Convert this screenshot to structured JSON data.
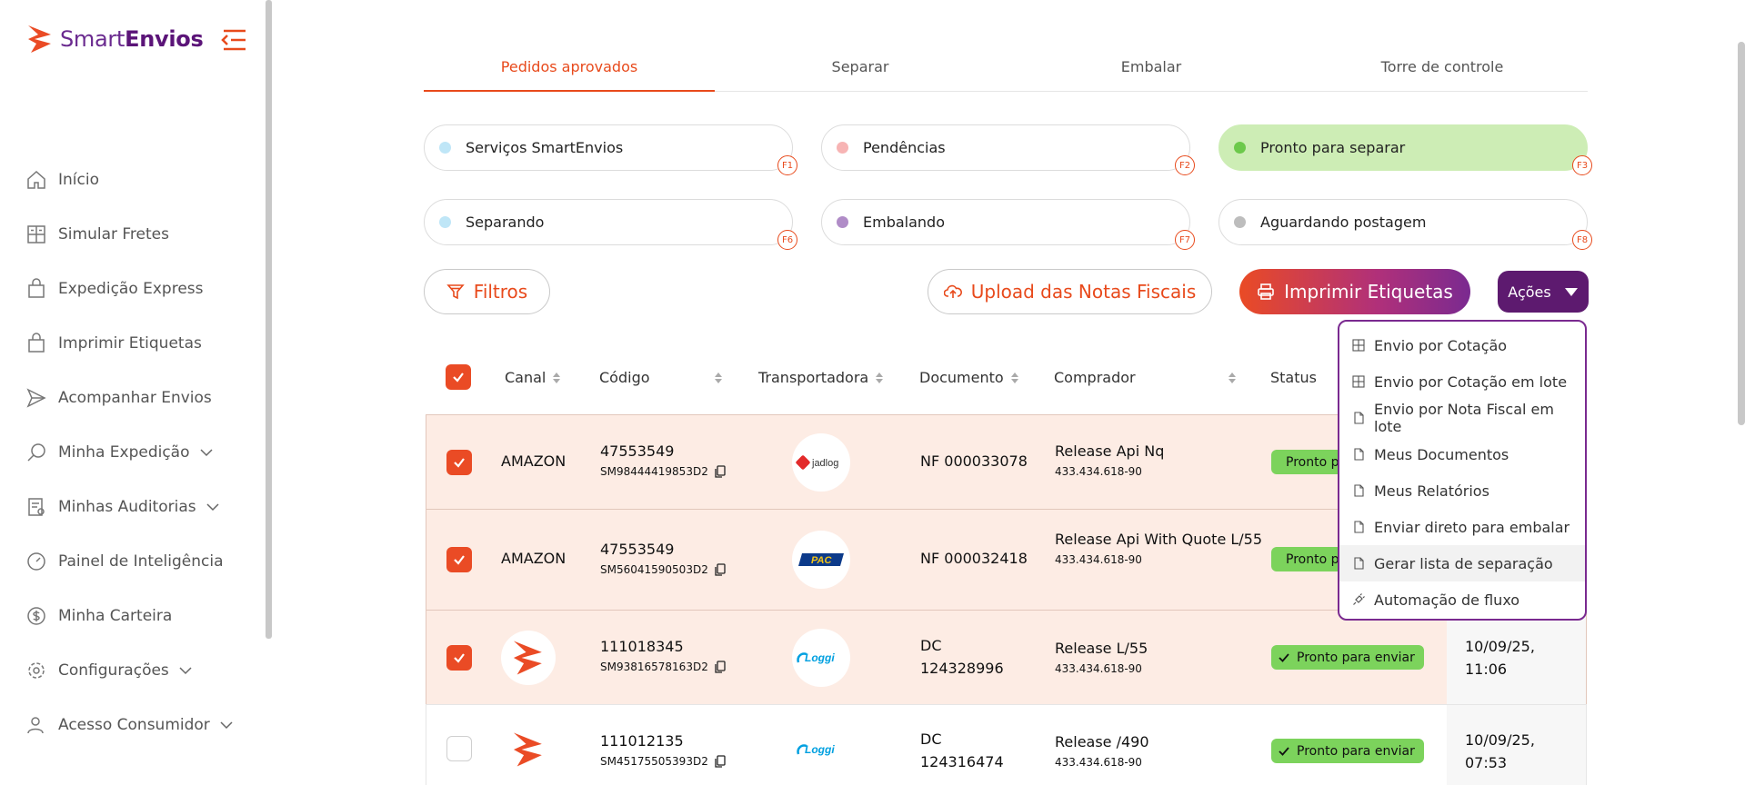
{
  "brand": {
    "name_part1": "Smart",
    "name_part2": "Envios",
    "color": "#e84a1c"
  },
  "sidebar": {
    "items": [
      {
        "label": "Início",
        "icon": "home-icon"
      },
      {
        "label": "Simular Fretes",
        "icon": "calculator-icon"
      },
      {
        "label": "Expedição Express",
        "icon": "bag-icon"
      },
      {
        "label": "Imprimir Etiquetas",
        "icon": "bag-icon"
      },
      {
        "label": "Acompanhar Envios",
        "icon": "send-icon"
      },
      {
        "label": "Minha Expedição",
        "icon": "search-icon",
        "expandable": true
      },
      {
        "label": "Minhas Auditorias",
        "icon": "audit-icon",
        "expandable": true
      },
      {
        "label": "Painel de Inteligência",
        "icon": "gauge-icon"
      },
      {
        "label": "Minha Carteira",
        "icon": "dollar-icon"
      },
      {
        "label": "Configurações",
        "icon": "gear-icon",
        "expandable": true
      },
      {
        "label": "Acesso Consumidor",
        "icon": "user-icon",
        "expandable": true
      }
    ]
  },
  "tabs": [
    {
      "label": "Pedidos aprovados",
      "active": true
    },
    {
      "label": "Separar"
    },
    {
      "label": "Embalar"
    },
    {
      "label": "Torre de controle"
    }
  ],
  "chips": [
    {
      "label": "Serviços SmartEnvios",
      "key": "F1",
      "dot": "#bfe6f7"
    },
    {
      "label": "Pendências",
      "key": "F2",
      "dot": "#f7b4b4"
    },
    {
      "label": "Pronto para separar",
      "key": "F3",
      "dot": "#6cc94b",
      "selected": true
    },
    {
      "label": "Separando",
      "key": "F6",
      "dot": "#bfe6f7"
    },
    {
      "label": "Embalando",
      "key": "F7",
      "dot": "#b08cc7"
    },
    {
      "label": "Aguardando postagem",
      "key": "F8",
      "dot": "#bdbdbd"
    }
  ],
  "actions": {
    "filters": "Filtros",
    "upload": "Upload das Notas Fiscais",
    "print": "Imprimir Etiquetas",
    "more": "Ações"
  },
  "table": {
    "headers": {
      "channel": "Canal",
      "code": "Código",
      "carrier": "Transportadora",
      "document": "Documento",
      "buyer": "Comprador",
      "status": "Status"
    },
    "rows": [
      {
        "checked": true,
        "channel": "AMAZON",
        "code": "47553549",
        "tracking": "SM98444419853D2",
        "carrier": "jadlog",
        "document": "NF 000033078",
        "buyer_name": "Release Api Nq",
        "buyer_doc": "433.434.618-90",
        "status": "Pronto para enviar",
        "date": "",
        "time": ""
      },
      {
        "checked": true,
        "channel": "AMAZON",
        "code": "47553549",
        "tracking": "SM56041590503D2",
        "carrier": "PAC",
        "document": "NF 000032418",
        "buyer_name": "Release Api With Quote L/55",
        "buyer_doc": "433.434.618-90",
        "status": "Pronto para enviar",
        "date": "",
        "time": ""
      },
      {
        "checked": true,
        "channel": "smartenvios",
        "code": "111018345",
        "tracking": "SM93816578163D2",
        "carrier": "Loggi",
        "document_line1": "DC",
        "document_line2": "124328996",
        "buyer_name": "Release L/55",
        "buyer_doc": "433.434.618-90",
        "status": "Pronto para enviar",
        "date": "10/09/25,",
        "time": "11:06"
      },
      {
        "checked": false,
        "channel": "smartenvios",
        "code": "111012135",
        "tracking": "SM45175505393D2",
        "carrier": "Loggi",
        "document_line1": "DC",
        "document_line2": "124316474",
        "buyer_name": "Release /490",
        "buyer_doc": "433.434.618-90",
        "status": "Pronto para enviar",
        "date": "10/09/25,",
        "time": "07:53"
      }
    ]
  },
  "dropdown": {
    "items": [
      {
        "label": "Envio por Cotação",
        "icon": "calculator-icon"
      },
      {
        "label": "Envio por Cotação em lote",
        "icon": "calculator-icon"
      },
      {
        "label": "Envio por Nota Fiscal em lote",
        "icon": "file-icon"
      },
      {
        "label": "Meus Documentos",
        "icon": "file-icon"
      },
      {
        "label": "Meus Relatórios",
        "icon": "file-icon"
      },
      {
        "label": "Enviar direto para embalar",
        "icon": "file-icon"
      },
      {
        "label": "Gerar lista de separação",
        "icon": "file-icon",
        "hover": true
      },
      {
        "label": "Automação de fluxo",
        "icon": "plug-icon"
      }
    ]
  }
}
